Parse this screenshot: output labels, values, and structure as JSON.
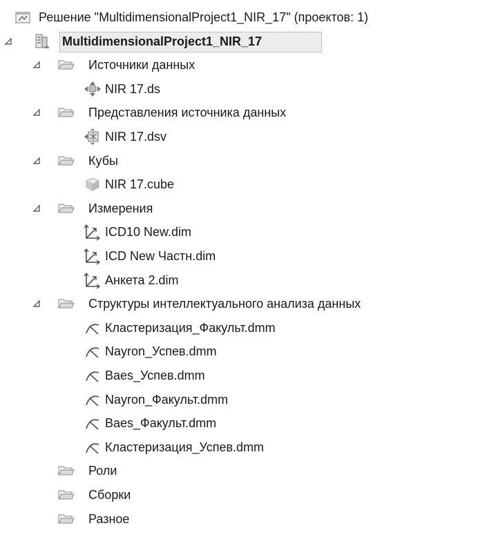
{
  "solution": {
    "label": "Решение \"MultidimensionalProject1_NIR_17\"  (проектов: 1)",
    "icon": "solution-icon"
  },
  "project": {
    "label": "MultidimensionalProject1_NIR_17",
    "icon": "project-icon",
    "selected": true,
    "expanded": true
  },
  "folders": [
    {
      "label": "Источники данных",
      "expanded": true,
      "items": [
        {
          "label": "NIR 17.ds",
          "icon": "data-source-icon"
        }
      ]
    },
    {
      "label": "Представления источника данных",
      "expanded": true,
      "items": [
        {
          "label": "NIR 17.dsv",
          "icon": "data-source-view-icon"
        }
      ]
    },
    {
      "label": "Кубы",
      "expanded": true,
      "items": [
        {
          "label": "NIR 17.cube",
          "icon": "cube-icon"
        }
      ]
    },
    {
      "label": "Измерения",
      "expanded": true,
      "items": [
        {
          "label": "ICD10 New.dim",
          "icon": "dimension-icon"
        },
        {
          "label": "ICD New Частн.dim",
          "icon": "dimension-icon"
        },
        {
          "label": "Анкета 2.dim",
          "icon": "dimension-icon"
        }
      ]
    },
    {
      "label": "Структуры интеллектуального анализа данных",
      "expanded": true,
      "items": [
        {
          "label": "Кластеризация_Факульт.dmm",
          "icon": "mining-structure-icon"
        },
        {
          "label": "Nayron_Успев.dmm",
          "icon": "mining-structure-icon"
        },
        {
          "label": "Baes_Успев.dmm",
          "icon": "mining-structure-icon"
        },
        {
          "label": "Nayron_Факульт.dmm",
          "icon": "mining-structure-icon"
        },
        {
          "label": "Baes_Факульт.dmm",
          "icon": "mining-structure-icon"
        },
        {
          "label": "Кластеризация_Успев.dmm",
          "icon": "mining-structure-icon"
        }
      ]
    },
    {
      "label": "Роли",
      "expanded": false,
      "items": []
    },
    {
      "label": "Сборки",
      "expanded": false,
      "items": []
    },
    {
      "label": "Разное",
      "expanded": false,
      "items": []
    }
  ]
}
